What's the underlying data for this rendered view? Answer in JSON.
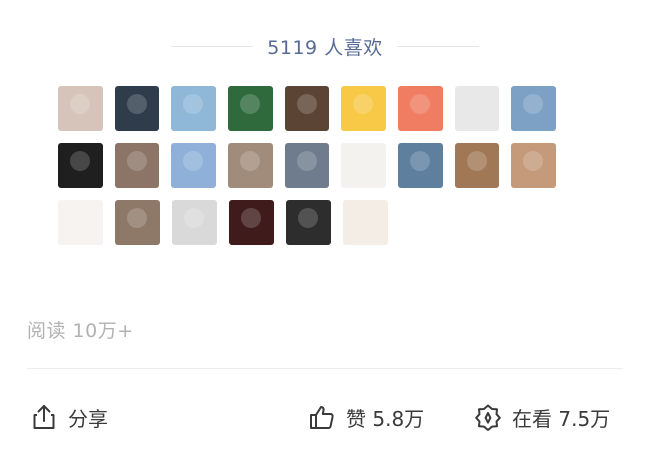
{
  "likes": {
    "count_text": "5119 人喜欢",
    "avatars": [
      [
        {
          "name": "avatar-1",
          "bg": "#d6c4ba"
        },
        {
          "name": "avatar-2",
          "bg": "#2f3c4c"
        },
        {
          "name": "avatar-3",
          "bg": "#8fb7d8"
        },
        {
          "name": "avatar-4",
          "bg": "#2f6a3d"
        },
        {
          "name": "avatar-5",
          "bg": "#5b4434"
        },
        {
          "name": "avatar-6",
          "bg": "#f7c947"
        },
        {
          "name": "avatar-7",
          "bg": "#f07c62"
        },
        {
          "name": "avatar-8",
          "bg": "#e8e8e8"
        },
        {
          "name": "avatar-9",
          "bg": "#7da1c5"
        }
      ],
      [
        {
          "name": "avatar-10",
          "bg": "#1f1f1f"
        },
        {
          "name": "avatar-11",
          "bg": "#8c7466"
        },
        {
          "name": "avatar-12",
          "bg": "#8fb1d9"
        },
        {
          "name": "avatar-13",
          "bg": "#a18c7c"
        },
        {
          "name": "avatar-14",
          "bg": "#6e7c8e"
        },
        {
          "name": "avatar-15",
          "bg": "#f4f2ef"
        },
        {
          "name": "avatar-16",
          "bg": "#5f7f9f"
        },
        {
          "name": "avatar-17",
          "bg": "#a07855"
        },
        {
          "name": "avatar-18",
          "bg": "#c49a7a"
        }
      ],
      [
        {
          "name": "avatar-19",
          "bg": "#f6f3f1"
        },
        {
          "name": "avatar-20",
          "bg": "#8e7868"
        },
        {
          "name": "avatar-21",
          "bg": "#d9d9d9"
        },
        {
          "name": "avatar-22",
          "bg": "#3f1b1b"
        },
        {
          "name": "avatar-23",
          "bg": "#2d2d2d"
        },
        {
          "name": "avatar-24",
          "bg": "#f3ede6"
        }
      ]
    ]
  },
  "reads": {
    "text": "阅读 10万+"
  },
  "actions": {
    "share_label": "分享",
    "like_label": "赞 5.8万",
    "watching_label": "在看 7.5万"
  },
  "colors": {
    "accent": "#576b95",
    "muted": "#b2b2b2",
    "action_text": "#3a3a3a"
  },
  "icons": {
    "share": "share-icon",
    "like": "thumbs-up-icon",
    "watching": "watching-icon"
  }
}
